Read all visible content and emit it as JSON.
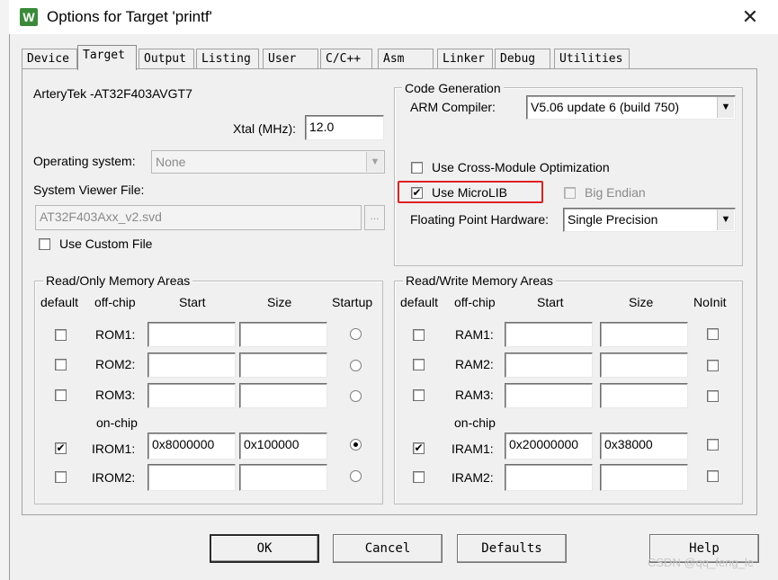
{
  "window": {
    "title": "Options for Target 'printf'",
    "app_icon": "W",
    "close_glyph": "✕"
  },
  "tabs": [
    "Device",
    "Target",
    "Output",
    "Listing",
    "User",
    "C/C++",
    "Asm",
    "Linker",
    "Debug",
    "Utilities"
  ],
  "active_tab": "Target",
  "device": {
    "name": "ArteryTek -AT32F403AVGT7",
    "xtal_label": "Xtal (MHz):",
    "xtal_value": "12.0",
    "os_label": "Operating system:",
    "os_value": "None",
    "svf_label": "System Viewer File:",
    "svf_value": "AT32F403Axx_v2.svd",
    "browse_label": "...",
    "custom_file_label": "Use Custom File"
  },
  "code_generation": {
    "title": "Code Generation",
    "compiler_label": "ARM Compiler:",
    "compiler_value": "V5.06 update 6 (build 750)",
    "cross_module_label": "Use Cross-Module Optimization",
    "cross_module_checked": false,
    "microlib_label": "Use MicroLIB",
    "microlib_checked": true,
    "big_endian_label": "Big Endian",
    "fph_label": "Floating Point Hardware:",
    "fph_value": "Single Precision",
    "highlight_color": "#e02020"
  },
  "ro_memory": {
    "title": "Read/Only Memory Areas",
    "headers": {
      "default": "default",
      "offchip": "off-chip",
      "start": "Start",
      "size": "Size",
      "extra": "Startup"
    },
    "onchip_label": "on-chip",
    "rows": [
      {
        "label": "ROM1:",
        "start": "",
        "size": "",
        "default": false,
        "startup": false
      },
      {
        "label": "ROM2:",
        "start": "",
        "size": "",
        "default": false,
        "startup": false
      },
      {
        "label": "ROM3:",
        "start": "",
        "size": "",
        "default": false,
        "startup": false
      },
      {
        "label": "IROM1:",
        "start": "0x8000000",
        "size": "0x100000",
        "default": true,
        "startup": true
      },
      {
        "label": "IROM2:",
        "start": "",
        "size": "",
        "default": false,
        "startup": false
      }
    ]
  },
  "rw_memory": {
    "title": "Read/Write Memory Areas",
    "headers": {
      "default": "default",
      "offchip": "off-chip",
      "start": "Start",
      "size": "Size",
      "extra": "NoInit"
    },
    "onchip_label": "on-chip",
    "rows": [
      {
        "label": "RAM1:",
        "start": "",
        "size": "",
        "default": false,
        "noinit": false
      },
      {
        "label": "RAM2:",
        "start": "",
        "size": "",
        "default": false,
        "noinit": false
      },
      {
        "label": "RAM3:",
        "start": "",
        "size": "",
        "default": false,
        "noinit": false
      },
      {
        "label": "IRAM1:",
        "start": "0x20000000",
        "size": "0x38000",
        "default": true,
        "noinit": false
      },
      {
        "label": "IRAM2:",
        "start": "",
        "size": "",
        "default": false,
        "noinit": false
      }
    ]
  },
  "buttons": {
    "ok": "OK",
    "cancel": "Cancel",
    "defaults": "Defaults",
    "help": "Help"
  },
  "watermark": "CSDN @qq_feng_le",
  "check_glyph": "✔"
}
